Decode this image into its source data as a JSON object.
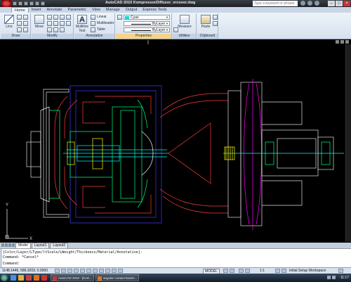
{
  "window": {
    "title": "AutoCAD 2010   KompressorDiffusor_vrcover.dwg",
    "search_placeholder": "Type a keyword or phrase"
  },
  "ribbon_tabs": [
    "Home",
    "Insert",
    "Annotate",
    "Parametric",
    "View",
    "Manage",
    "Output",
    "Express Tools"
  ],
  "ribbon": {
    "draw": {
      "title": "Draw",
      "line": "Line"
    },
    "modify": {
      "title": "Modify",
      "move": "Move"
    },
    "annotation": {
      "title": "Annotation",
      "multiline_text": "Multiline Text",
      "linear": "Linear",
      "multileader": "Multileader",
      "table": "Table"
    },
    "properties": {
      "title": "Properties",
      "color_value": "Cyan",
      "linetype_value": "ByLayer",
      "lineweight_value": "ByLayer"
    },
    "utilities": {
      "title": "Utilities",
      "measure": "Measure"
    },
    "clipboard": {
      "title": "Clipboard",
      "paste": "Paste"
    }
  },
  "layout_tabs": [
    "Model",
    "Layout1",
    "Layout2"
  ],
  "command_line": {
    "history": [
      "[Color/Layer/LType/ltScale/LWeight/Thickness/Material/Annotative]:",
      "Command: *Cancel*"
    ],
    "prompt": "Command:"
  },
  "status_bar": {
    "coordinates": "1148.1445, 586.3203, 0.0000",
    "model": "MODEL",
    "scale": "1:1",
    "workspace": "Initial Setup Workspace"
  },
  "taskbar": {
    "tasks": [
      "AutoCAD 2010 - [Kom...",
      "angular contact bearin..."
    ],
    "clock": "11:17"
  },
  "colors": {
    "drawing_bg": "#000000",
    "ribbon_bg": "#dde6f1",
    "accent": "#f6d487"
  }
}
